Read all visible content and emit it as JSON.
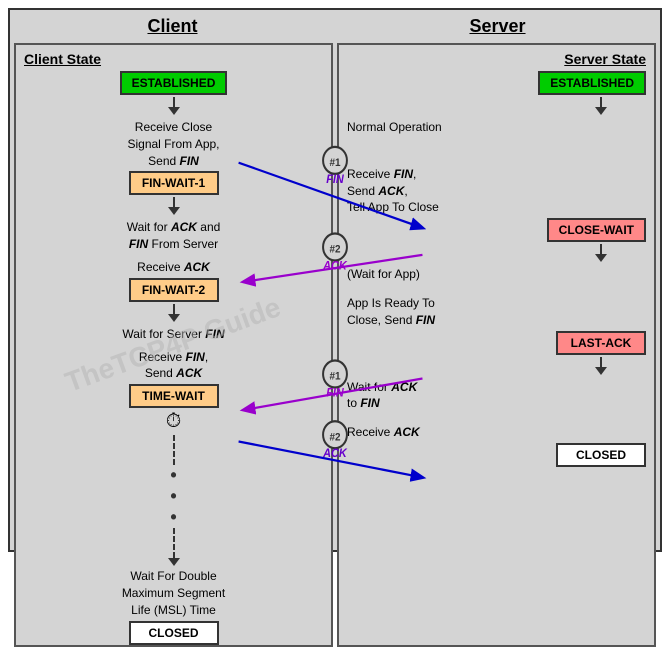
{
  "header": {
    "client_title": "Client",
    "server_title": "Server"
  },
  "client": {
    "section_title": "Client State",
    "states": {
      "established": "ESTABLISHED",
      "finwait1": "FIN-WAIT-1",
      "finwait2": "FIN-WAIT-2",
      "timewait": "TIME-WAIT",
      "closed": "CLOSED"
    },
    "descriptions": {
      "d1": "Receive Close Signal From App, Send FIN",
      "d2": "Wait for ACK and FIN From Server",
      "d3": "Receive ACK",
      "d4": "Wait for Server FIN",
      "d5": "Receive FIN, Send ACK",
      "d6": "Wait For Double Maximum Segment Life (MSL) Time"
    }
  },
  "server": {
    "section_title": "Server State",
    "states": {
      "established": "ESTABLISHED",
      "closewait": "CLOSE-WAIT",
      "lastack": "LAST-ACK",
      "closed": "CLOSED"
    },
    "descriptions": {
      "d1": "Normal Operation",
      "d2": "Receive FIN, Send ACK, Tell App To Close",
      "d3": "(Wait for App)",
      "d4": "App Is Ready To Close, Send FIN",
      "d5": "Wait for ACK to FIN",
      "d6": "Receive ACK"
    }
  },
  "arrows": {
    "fin1_label": "FIN",
    "ack1_label": "ACK",
    "fin2_label": "FIN",
    "ack2_label": "ACK",
    "circle1": "#1",
    "circle2": "#2"
  },
  "watermark": "TheTCP4P Guide"
}
